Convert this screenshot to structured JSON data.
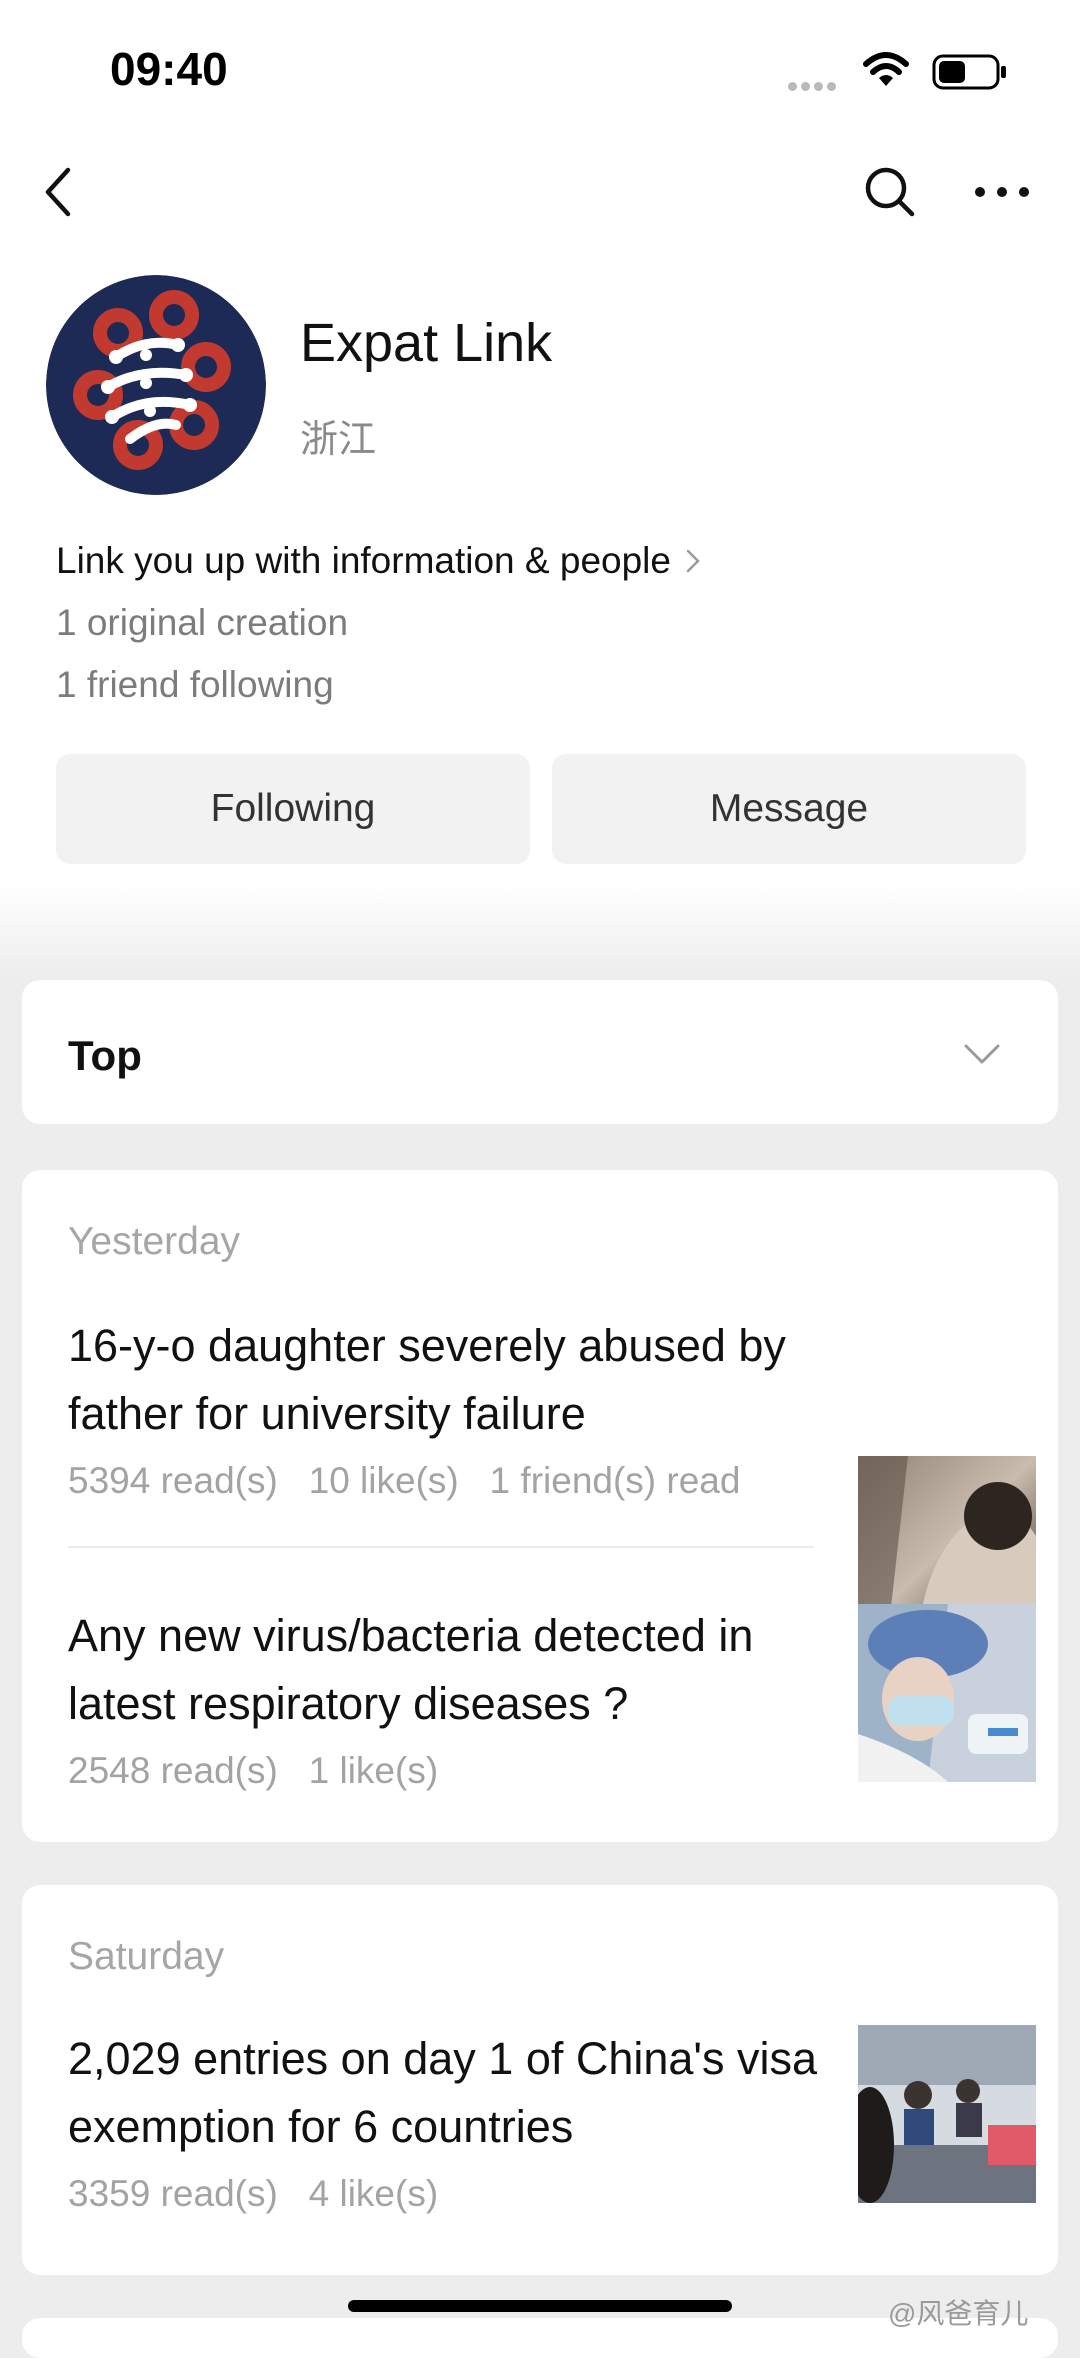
{
  "status_bar": {
    "time": "09:40"
  },
  "profile": {
    "name": "Expat Link",
    "region": "浙江",
    "bio": "Link you up with information & people",
    "original_creations": "1 original creation",
    "friends_following": "1 friend following"
  },
  "actions": {
    "following_label": "Following",
    "message_label": "Message"
  },
  "top_section": {
    "label": "Top"
  },
  "groups": [
    {
      "date": "Yesterday",
      "articles": [
        {
          "title": "16-y-o daughter severely abused by father for university failure",
          "meta": "5394 read(s)   10 like(s)   1 friend(s) read"
        },
        {
          "title": "Any new virus/bacteria detected in latest respiratory diseases ?",
          "meta": "2548 read(s)   1 like(s)"
        }
      ]
    },
    {
      "date": "Saturday",
      "articles": [
        {
          "title": "2,029 entries on day 1 of China's visa exemption for 6 countries",
          "meta": "3359 read(s)   4 like(s)"
        }
      ]
    }
  ],
  "watermark": "@风爸育儿",
  "colors": {
    "avatar_bg": "#1c2a55",
    "avatar_knot": "#c23a2f",
    "button_bg": "#f2f2f2",
    "page_bg": "#ededed"
  }
}
